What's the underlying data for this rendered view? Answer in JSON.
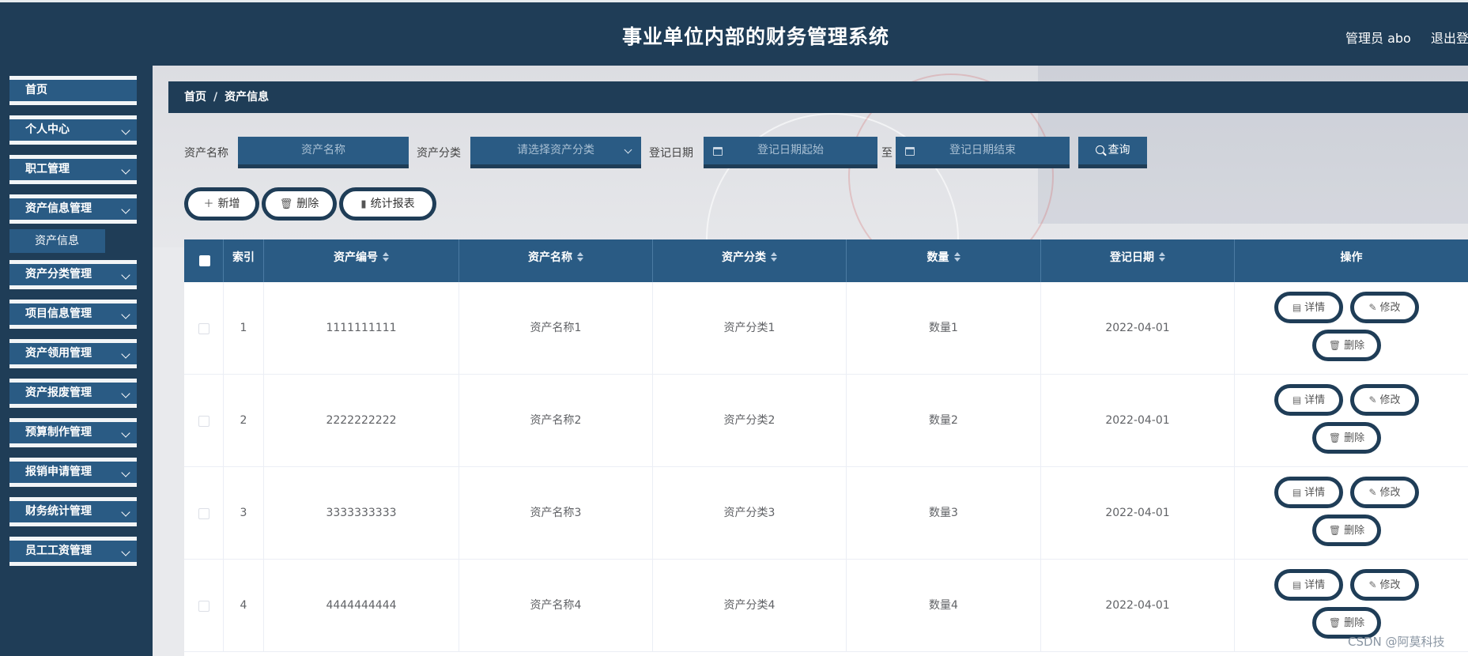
{
  "header": {
    "title": "事业单位内部的财务管理系统",
    "user": "管理员 abo",
    "logout": "退出登"
  },
  "sidebar": {
    "items": [
      {
        "label": "首页"
      },
      {
        "label": "个人中心"
      },
      {
        "label": "职工管理"
      },
      {
        "label": "资产信息管理"
      },
      {
        "label": "资产分类管理"
      },
      {
        "label": "项目信息管理"
      },
      {
        "label": "资产领用管理"
      },
      {
        "label": "资产报废管理"
      },
      {
        "label": "预算制作管理"
      },
      {
        "label": "报销申请管理"
      },
      {
        "label": "财务统计管理"
      },
      {
        "label": "员工工资管理"
      }
    ],
    "sub_item": "资产信息"
  },
  "breadcrumb": {
    "home": "首页",
    "sep": "/",
    "current": "资产信息"
  },
  "search": {
    "name_label": "资产名称",
    "name_placeholder": "资产名称",
    "category_label": "资产分类",
    "category_placeholder": "请选择资产分类",
    "date_label": "登记日期",
    "date_start_placeholder": "登记日期起始",
    "date_to": "至",
    "date_end_placeholder": "登记日期结束",
    "query": "查询"
  },
  "actions": {
    "add": "新增",
    "delete": "删除",
    "report": "统计报表"
  },
  "table": {
    "headers": [
      "索引",
      "资产编号",
      "资产名称",
      "资产分类",
      "数量",
      "登记日期",
      "操作"
    ],
    "rows": [
      {
        "index": "1",
        "code": "1111111111",
        "name": "资产名称1",
        "category": "资产分类1",
        "qty": "数量1",
        "date": "2022-04-01"
      },
      {
        "index": "2",
        "code": "2222222222",
        "name": "资产名称2",
        "category": "资产分类2",
        "qty": "数量2",
        "date": "2022-04-01"
      },
      {
        "index": "3",
        "code": "3333333333",
        "name": "资产名称3",
        "category": "资产分类3",
        "qty": "数量3",
        "date": "2022-04-01"
      },
      {
        "index": "4",
        "code": "4444444444",
        "name": "资产名称4",
        "category": "资产分类4",
        "qty": "数量4",
        "date": "2022-04-01"
      }
    ],
    "op": {
      "detail": "详情",
      "edit": "修改",
      "delete": "删除"
    }
  },
  "watermark": "CSDN @阿莫科技",
  "colors": {
    "header_bg": "#1f3d57",
    "accent": "#2a5b84"
  }
}
